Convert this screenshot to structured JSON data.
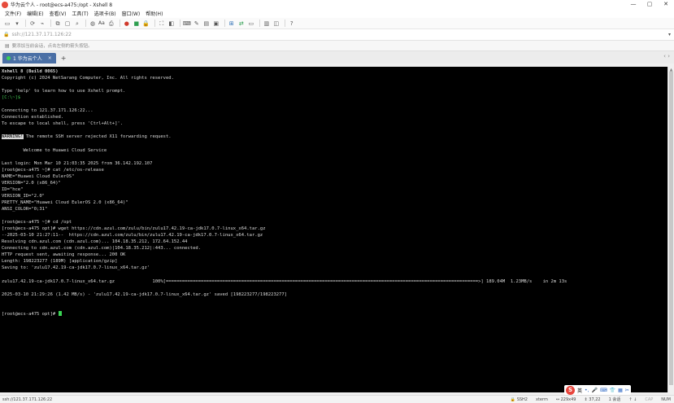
{
  "window": {
    "title": "华为云个人 - root@ecs-a475:/opt - Xshell 8",
    "minimize": "—",
    "maximize": "▢",
    "close": "✕"
  },
  "menu": [
    "文件(F)",
    "编辑(E)",
    "查看(V)",
    "工具(T)",
    "选项卡(B)",
    "窗口(W)",
    "帮助(H)"
  ],
  "toolbar": {
    "font_label": "Aa"
  },
  "address": {
    "value": "ssh://121.37.171.126:22"
  },
  "hint": {
    "text": "要添加当前会话，点击左侧的箭头按钮。"
  },
  "tab": {
    "label": "1 华为云个人",
    "close": "×",
    "add": "+"
  },
  "terminal": {
    "lines": [
      "Xshell 8 (Build 0065)",
      "Copyright (c) 2024 NetSarang Computer, Inc. All rights reserved.",
      "",
      "Type 'help' to learn how to use Xshell prompt.",
      "[C:\\~]$",
      "",
      "Connecting to 121.37.171.126:22...",
      "Connection established.",
      "To escape to local shell, press 'Ctrl+Alt+]'.",
      "",
      "WARNING! The remote SSH server rejected X11 forwarding request.",
      "",
      "        Welcome to Huawei Cloud Service",
      "",
      "Last login: Mon Mar 10 21:03:35 2025 from 36.142.192.107",
      "[root@ecs-a475 ~]# cat /etc/os-release",
      "NAME=\"Huawei Cloud EulerOS\"",
      "VERSION=\"2.0 (x86_64)\"",
      "ID=\"hce\"",
      "VERSION_ID=\"2.0\"",
      "PRETTY_NAME=\"Huawei Cloud EulerOS 2.0 (x86_64)\"",
      "ANSI_COLOR=\"0;31\"",
      "",
      "[root@ecs-a475 ~]# cd /opt",
      "[root@ecs-a475 opt]# wget https://cdn.azul.com/zulu/bin/zulu17.42.19-ca-jdk17.0.7-linux_x64.tar.gz",
      "--2025-03-10 21:27:11--  https://cdn.azul.com/zulu/bin/zulu17.42.19-ca-jdk17.0.7-linux_x64.tar.gz",
      "Resolving cdn.azul.com (cdn.azul.com)... 104.18.35.212, 172.64.152.44",
      "Connecting to cdn.azul.com (cdn.azul.com)|104.18.35.212|:443... connected.",
      "HTTP request sent, awaiting response... 200 OK",
      "Length: 198223277 (189M) [application/gzip]",
      "Saving to: 'zulu17.42.19-ca-jdk17.0.7-linux_x64.tar.gz'",
      "",
      "zulu17.42.19-ca-jdk17.0.7-linux_x64.tar.gz              100%[====================================================================================================================>] 189.04M  1.23MB/s    in 2m 13s",
      "",
      "2025-03-10 21:29:26 (1.42 MB/s) - 'zulu17.42.19-ca-jdk17.0.7-linux_x64.tar.gz' saved [198223277/198223277]",
      "",
      "",
      "[root@ecs-a475 opt]# "
    ]
  },
  "ime": {
    "logo": "S",
    "lang": "英",
    "items": [
      "•,",
      "🎤",
      "⌨",
      "👕",
      "▦",
      "✂"
    ]
  },
  "status": {
    "connection": "ssh://121.37.171.126:22",
    "protocol": "SSH2",
    "term": "xterm",
    "size": "229x49",
    "pos": "37,22",
    "sessions": "1 会话",
    "cap": "CAP",
    "num": "NUM"
  },
  "colors": {
    "prompt_cursor": "#39d353",
    "tab_active": "#4a6fa5"
  }
}
